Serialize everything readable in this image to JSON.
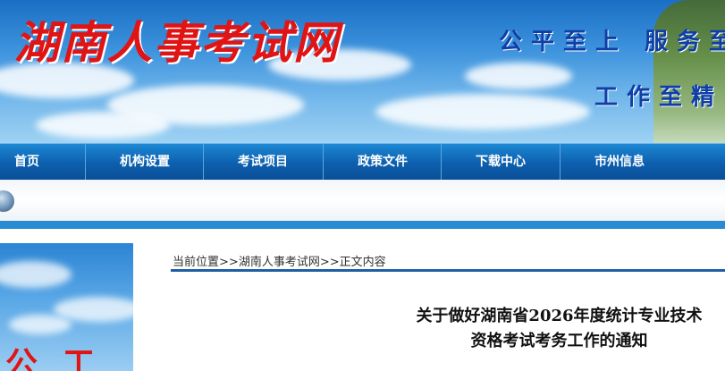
{
  "header": {
    "site_title": "湖南人事考试网",
    "slogan_line1": "公平至上 服务至",
    "slogan_line2": "工作至精"
  },
  "nav": {
    "items": [
      {
        "label": "首页",
        "width": 96,
        "pad": 16
      },
      {
        "label": "机构设置",
        "width": 132,
        "pad": 38
      },
      {
        "label": "考试项目",
        "width": 134,
        "pad": 38
      },
      {
        "label": "政策文件",
        "width": 132,
        "pad": 38
      },
      {
        "label": "下载中心",
        "width": 133,
        "pad": 38
      },
      {
        "label": "市州信息",
        "width": 184,
        "pad": 38
      }
    ]
  },
  "sidebar_image": {
    "text": "公工"
  },
  "breadcrumb": {
    "prefix": "当前位置",
    "sep1": ">>",
    "link": "湖南人事考试网",
    "sep2": ">>",
    "current": "正文内容"
  },
  "article": {
    "title_line1": "关于做好湖南省2026年度统计专业技术",
    "title_line2": "资格考试考务工作的通知"
  },
  "colors": {
    "nav_bg": "#0d5fae",
    "title_red": "#e01414",
    "slogan_blue": "#0e3fa8",
    "crumb_line": "#1f5fa8"
  }
}
